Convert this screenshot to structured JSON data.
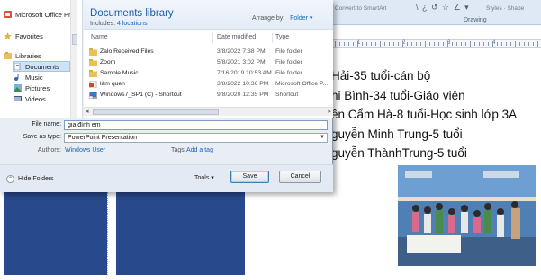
{
  "ribbon": {
    "convert_label": "Convert to SmartArt",
    "shapes_glyphs": "\\ ¿ ↺ ☆ ∠ ▾",
    "styles_label": "Styles · Shape",
    "group_label": "Drawing"
  },
  "ruler": {
    "numbers": [
      "1",
      "2",
      "3",
      "4"
    ]
  },
  "dialog": {
    "library_title": "Documents library",
    "includes_prefix": "Includes:",
    "includes_link": "4 locations",
    "arrange_label": "Arrange by:",
    "arrange_value": "Folder",
    "columns": {
      "name": "Name",
      "date": "Date modified",
      "type": "Type"
    },
    "files": [
      {
        "name": "Zalo Received Files",
        "date": "3/8/2022 7:38 PM",
        "type": "File folder",
        "icon": "folder-icon"
      },
      {
        "name": "Zoom",
        "date": "5/8/2021 3:02 PM",
        "type": "File folder",
        "icon": "folder-icon"
      },
      {
        "name": "Sample Music",
        "date": "7/16/2019 10:53 AM",
        "type": "File folder",
        "icon": "folder-icon"
      },
      {
        "name": "làm quen",
        "date": "3/8/2022 10:36 PM",
        "type": "Microsoft Office P...",
        "icon": "ppt-file-icon"
      },
      {
        "name": "Windows7_SP1 (C) - Shortcut",
        "date": "9/8/2020 12:35 PM",
        "type": "Shortcut",
        "icon": "shortcut-icon"
      }
    ],
    "nav": {
      "office_item": "Microsoft Office Pr",
      "favorites": "Favorites",
      "libraries": "Libraries",
      "documents": "Documents",
      "music": "Music",
      "pictures": "Pictures",
      "videos": "Videos"
    },
    "form": {
      "filename_label": "File name:",
      "filename_value": "gia đình em",
      "savetype_label": "Save as type:",
      "savetype_value": "PowerPoint Presentation",
      "authors_label": "Authors:",
      "authors_value": "Windows User",
      "tags_label": "Tags:",
      "tags_value": "Add a tag"
    },
    "footer": {
      "hide_folders": "Hide Folders",
      "tools": "Tools",
      "save": "Save",
      "cancel": "Cancel"
    }
  },
  "document_lines": [
    "Hải-35 tuổi-cán bộ",
    "hị Bình-34 tuổi-Giáo viên",
    "ên Cẩm Hà-8 tuổi-Học sinh lớp 3A",
    "guyễn Minh Trung-5 tuổi",
    "guyễn ThànhTrung-5 tuổi"
  ],
  "colors": {
    "accent": "#1d5aa8",
    "link": "#1565c0",
    "slide_blue": "#28498b",
    "folder": "#e8c15a"
  }
}
